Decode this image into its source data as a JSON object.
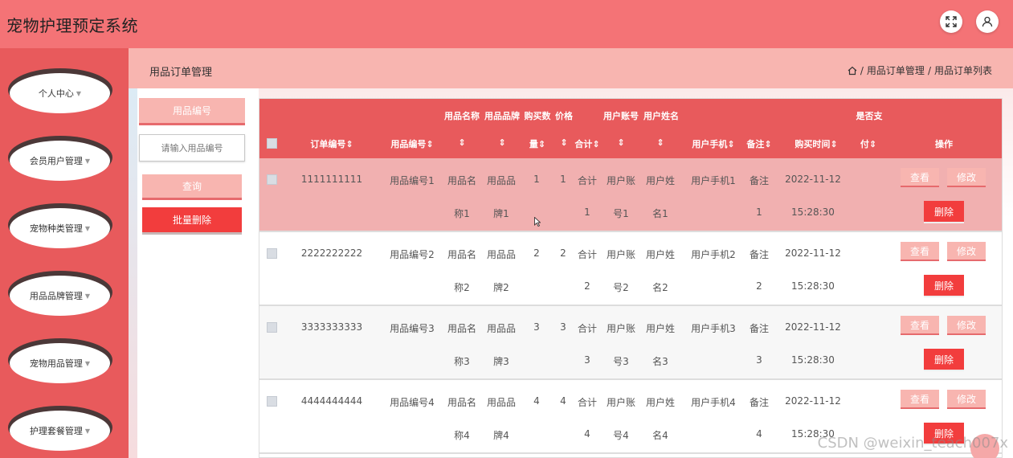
{
  "app": {
    "title": "宠物护理预定系统"
  },
  "header": {
    "fullscreen_icon": "expand-icon",
    "user_icon": "user-icon"
  },
  "sidebar": {
    "items": [
      {
        "label": "个人中心"
      },
      {
        "label": "会员用户管理"
      },
      {
        "label": "宠物种类管理"
      },
      {
        "label": "用品品牌管理"
      },
      {
        "label": "宠物用品管理"
      },
      {
        "label": "护理套餐管理"
      }
    ]
  },
  "page": {
    "title": "用品订单管理",
    "breadcrumb": [
      "用品订单管理",
      "用品订单列表"
    ],
    "breadcrumb_sep": "/"
  },
  "search": {
    "field_label": "用品编号",
    "placeholder": "请输入用品编号",
    "query_button": "查询",
    "batch_delete_button": "批量删除"
  },
  "table": {
    "headers": {
      "order_no": "订单编号",
      "item_no": "用品编号",
      "item_name": "用品名称",
      "brand": "用品品牌",
      "qty_top": "购买数",
      "qty_bottom": "量",
      "price": "价格",
      "total": "合计",
      "account": "用户账号",
      "username": "用户姓名",
      "phone": "用户手机",
      "note": "备注",
      "time": "购买时间",
      "paid_top": "是否支",
      "paid_bottom": "付",
      "ops": "操作"
    },
    "rows": [
      {
        "order_no": "1111111111",
        "item_no": "用品编号1",
        "name_a": "用品名",
        "name_b": "称1",
        "brand_a": "用品品",
        "brand_b": "牌1",
        "qty": "1",
        "price": "1",
        "total_a": "合计",
        "total_b": "1",
        "acc_a": "用户账",
        "acc_b": "号1",
        "user_a": "用户姓",
        "user_b": "名1",
        "phone": "用户手机1",
        "note_a": "备注",
        "note_b": "1",
        "date": "2022-11-12",
        "time": "15:28:30",
        "highlight": true
      },
      {
        "order_no": "2222222222",
        "item_no": "用品编号2",
        "name_a": "用品名",
        "name_b": "称2",
        "brand_a": "用品品",
        "brand_b": "牌2",
        "qty": "2",
        "price": "2",
        "total_a": "合计",
        "total_b": "2",
        "acc_a": "用户账",
        "acc_b": "号2",
        "user_a": "用户姓",
        "user_b": "名2",
        "phone": "用户手机2",
        "note_a": "备注",
        "note_b": "2",
        "date": "2022-11-12",
        "time": "15:28:30",
        "highlight": false
      },
      {
        "order_no": "3333333333",
        "item_no": "用品编号3",
        "name_a": "用品名",
        "name_b": "称3",
        "brand_a": "用品品",
        "brand_b": "牌3",
        "qty": "3",
        "price": "3",
        "total_a": "合计",
        "total_b": "3",
        "acc_a": "用户账",
        "acc_b": "号3",
        "user_a": "用户姓",
        "user_b": "名3",
        "phone": "用户手机3",
        "note_a": "备注",
        "note_b": "3",
        "date": "2022-11-12",
        "time": "15:28:30",
        "highlight": false
      },
      {
        "order_no": "4444444444",
        "item_no": "用品编号4",
        "name_a": "用品名",
        "name_b": "称4",
        "brand_a": "用品品",
        "brand_b": "牌4",
        "qty": "4",
        "price": "4",
        "total_a": "合计",
        "total_b": "4",
        "acc_a": "用户账",
        "acc_b": "号4",
        "user_a": "用户姓",
        "user_b": "名4",
        "phone": "用户手机4",
        "note_a": "备注",
        "note_b": "4",
        "date": "2022-11-12",
        "time": "15:28:30",
        "highlight": false
      }
    ],
    "actions": {
      "view": "查看",
      "edit": "修改",
      "delete": "删除"
    }
  },
  "colors": {
    "header": "#f47376",
    "sidebar": "#e85a5c",
    "subheader": "#f8b5b0",
    "danger": "#f23d3d",
    "row_highlight": "#f1b0b0"
  },
  "watermark": "CSDN @weixin_teach007x"
}
